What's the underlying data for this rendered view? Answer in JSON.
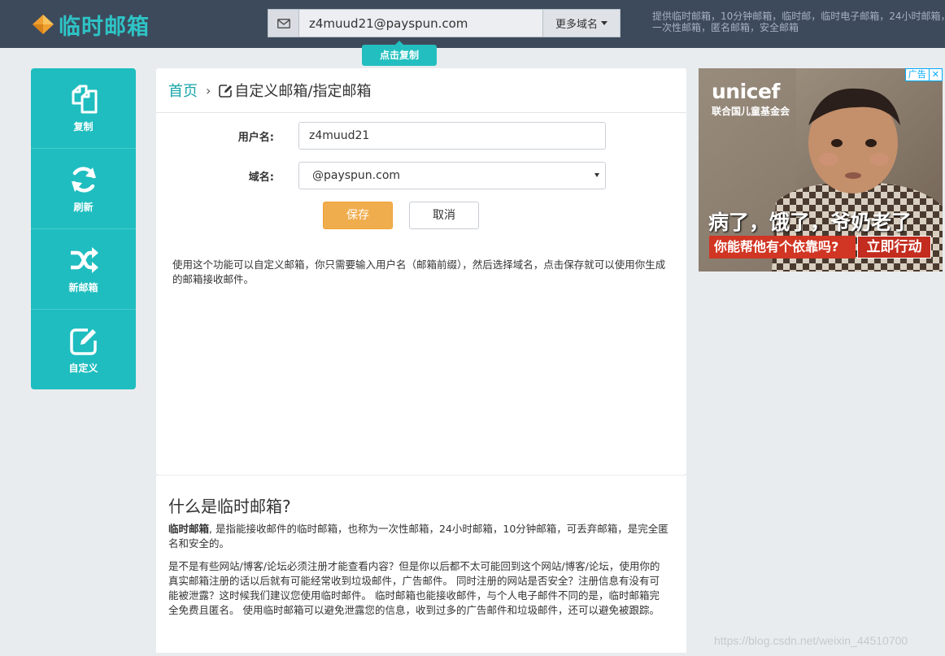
{
  "header": {
    "logo_text": "临时邮箱",
    "email_value": "z4muud21@payspun.com",
    "more_domains_label": "更多域名",
    "copy_tip": "点击复制",
    "tagline": "提供临时邮箱，10分钟邮箱，临时邮，临时电子邮箱，24小时邮箱，一次性邮箱，匿名邮箱，安全邮箱"
  },
  "sidebar": {
    "items": [
      {
        "label": "复制",
        "icon": "copy-icon"
      },
      {
        "label": "刷新",
        "icon": "refresh-icon"
      },
      {
        "label": "新邮箱",
        "icon": "shuffle-icon"
      },
      {
        "label": "自定义",
        "icon": "edit-icon"
      }
    ]
  },
  "breadcrumb": {
    "home": "首页",
    "current": "自定义邮箱/指定邮箱"
  },
  "form": {
    "username_label": "用户名:",
    "username_value": "z4muud21",
    "domain_label": "域名:",
    "domain_value": "@payspun.com",
    "save_label": "保存",
    "cancel_label": "取消",
    "description": "使用这个功能可以自定义邮箱，你只需要输入用户名（邮箱前缀），然后选择域名，点击保存就可以使用你生成的邮箱接收邮件。"
  },
  "about": {
    "title": "什么是临时邮箱?",
    "p1_strong": "临时邮箱",
    "p1_rest": ", 是指能接收邮件的临时邮箱，也称为一次性邮箱，24小时邮箱，10分钟邮箱，可丢弃邮箱，是完全匿名和安全的。",
    "p2": "是不是有些网站/博客/论坛必须注册才能查看内容？但是你以后都不太可能回到这个网站/博客/论坛，使用你的真实邮箱注册的话以后就有可能经常收到垃圾邮件，广告邮件。 同时注册的网站是否安全？注册信息有没有可能被泄露？这时候我们建议您使用临时邮件。 临时邮箱也能接收邮件，与个人电子邮件不同的是，临时邮箱完全免费且匿名。 使用临时邮箱可以避免泄露您的信息，收到过多的广告邮件和垃圾邮件，还可以避免被跟踪。"
  },
  "ad": {
    "badge": "广告",
    "close": "✕",
    "brand": "unicef",
    "org": "联合国儿童基金会",
    "headline": "病了，饿了，爷奶老了",
    "sub": "你能帮他有个依靠吗?",
    "cta": "立即行动"
  },
  "watermark": "https://blog.csdn.net/weixin_44510700",
  "colors": {
    "topbar": "#3d4a5c",
    "accent": "#1fbdbf",
    "save": "#f0ad4e",
    "link": "#1aa5a7"
  }
}
